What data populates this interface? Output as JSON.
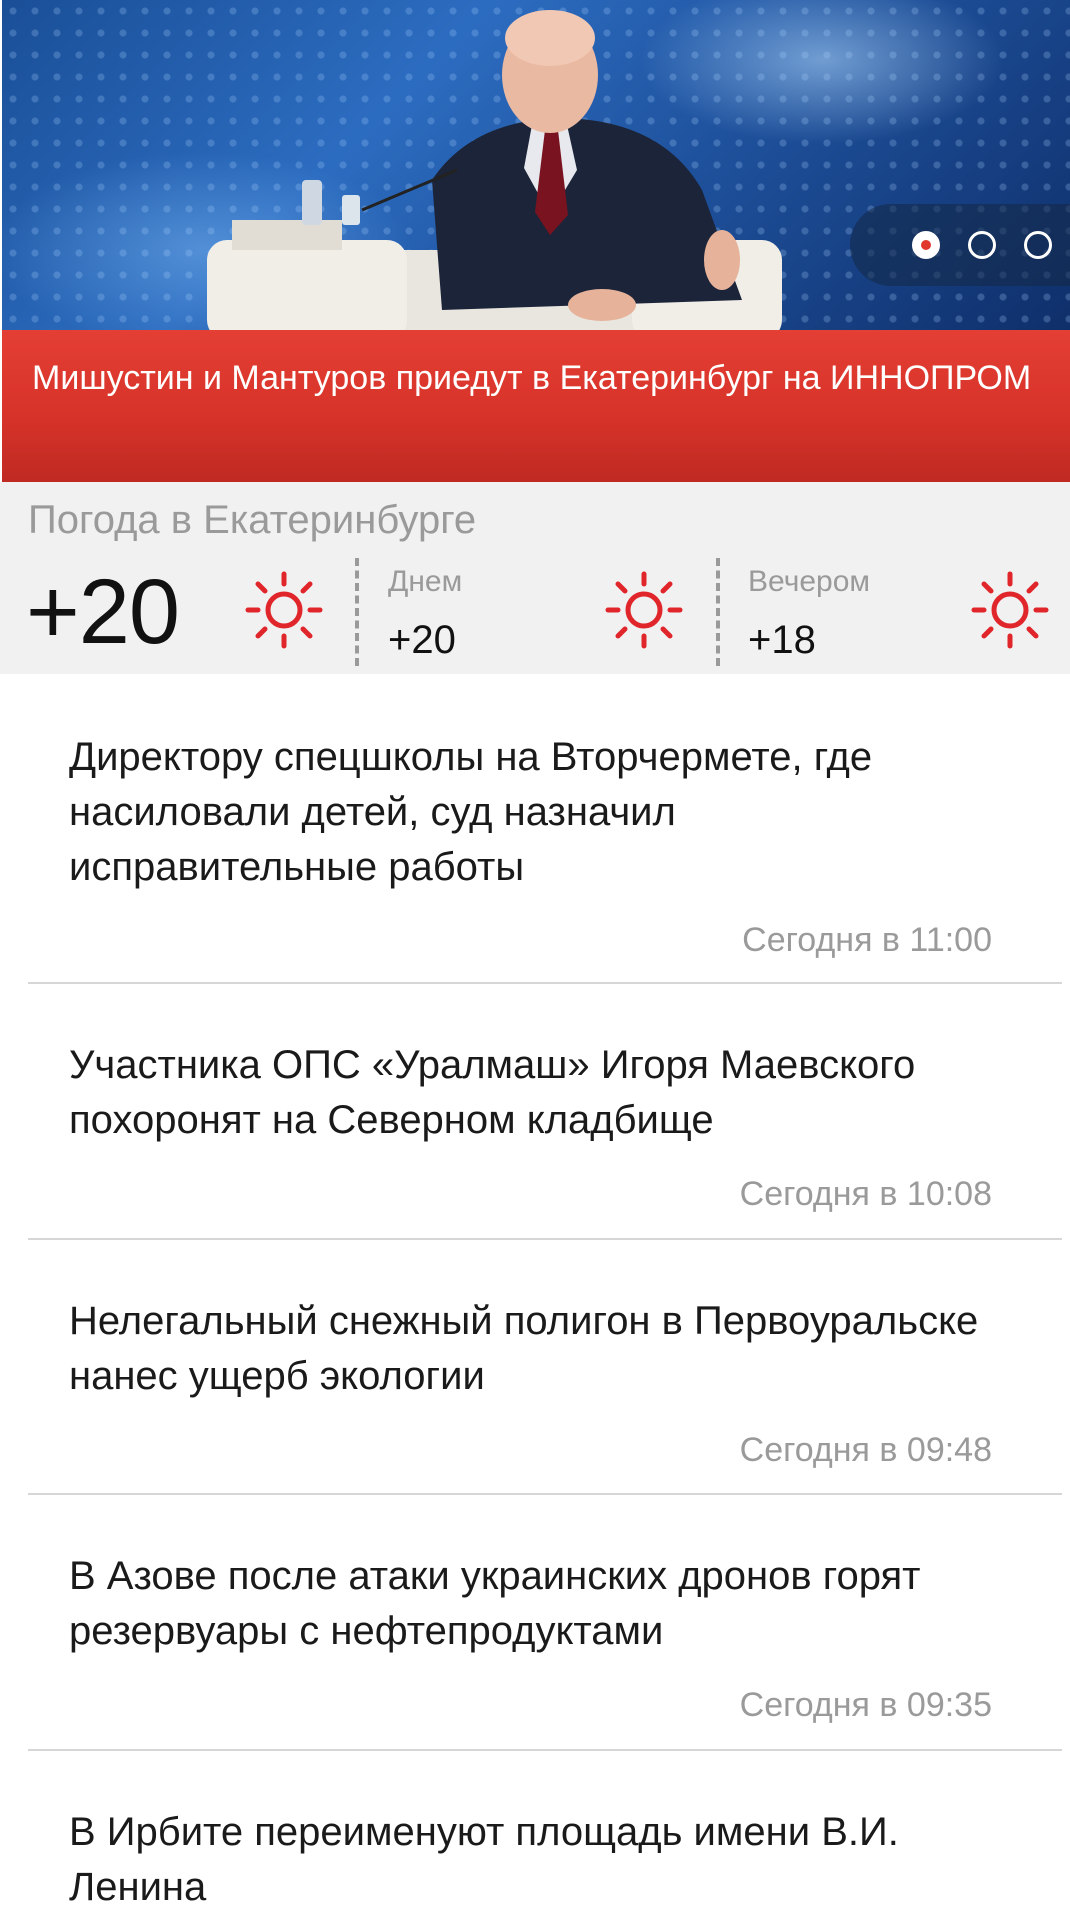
{
  "hero": {
    "caption": "Мишустин и Мантуров приедут в Екатеринбург на ИННОПРОМ",
    "slides_total": 3,
    "active_slide": 1,
    "image_description_icon": "photo-icon"
  },
  "weather": {
    "title": "Погода в Екатеринбурге",
    "now_temp": "+20",
    "now_icon": "sun-icon",
    "periods": [
      {
        "label": "Днем",
        "temp": "+20",
        "icon": "sun-icon"
      },
      {
        "label": "Вечером",
        "temp": "+18",
        "icon": "sun-icon"
      }
    ]
  },
  "news": [
    {
      "title": "Директору спецшколы на Вторчермете, где насиловали детей, суд назначил исправительные работы",
      "time": "Сегодня в 11:00"
    },
    {
      "title": "Участника ОПС «Уралмаш» Игоря Маевского похоронят на Северном кладбище",
      "time": "Сегодня в 10:08"
    },
    {
      "title": "Нелегальный снежный полигон в Первоуральске нанес ущерб экологии",
      "time": "Сегодня в 09:48"
    },
    {
      "title": "В Азове после атаки украинских дронов горят резервуары с нефтепродуктами",
      "time": "Сегодня в 09:35"
    },
    {
      "title": "В Ирбите переименуют площадь имени В.И. Ленина",
      "time": ""
    }
  ],
  "colors": {
    "accent_red": "#d8332a",
    "weather_bg": "#f1f1f1",
    "muted_text": "#9a9a9a",
    "sun_red": "#e0262b"
  }
}
